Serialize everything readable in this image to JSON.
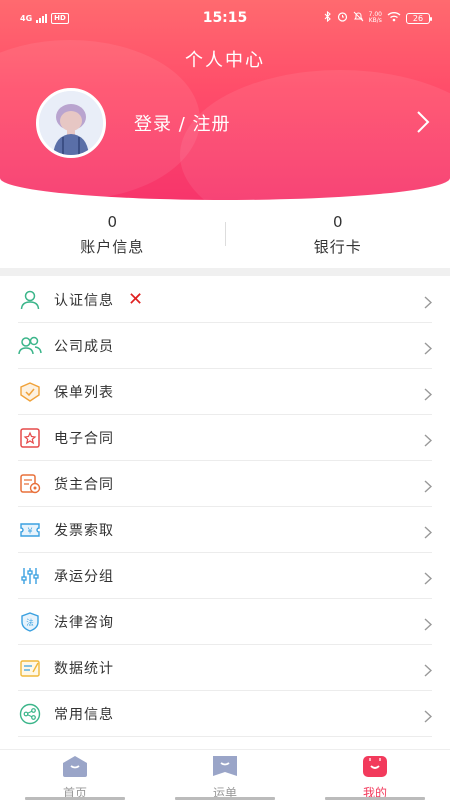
{
  "status_bar": {
    "network": "4G",
    "hd": "HD",
    "time": "15:15",
    "speed_value": "7.00",
    "speed_unit": "KB/s",
    "battery": "26"
  },
  "header": {
    "title": "个人中心",
    "login_label": "登录 / 注册"
  },
  "stats": [
    {
      "value": "0",
      "label": "账户信息"
    },
    {
      "value": "0",
      "label": "银行卡"
    }
  ],
  "menu": [
    {
      "label": "认证信息",
      "icon": "person-icon",
      "color": "#3bb58a",
      "status": "✕"
    },
    {
      "label": "公司成员",
      "icon": "group-icon",
      "color": "#3bb58a"
    },
    {
      "label": "保单列表",
      "icon": "policy-shield-icon",
      "color": "#f0a23a"
    },
    {
      "label": "电子合同",
      "icon": "e-contract-icon",
      "color": "#e64a4a"
    },
    {
      "label": "货主合同",
      "icon": "shipper-contract-icon",
      "color": "#e8703a"
    },
    {
      "label": "发票索取",
      "icon": "invoice-icon",
      "color": "#3aa0e0"
    },
    {
      "label": "承运分组",
      "icon": "sliders-icon",
      "color": "#3aa0e0"
    },
    {
      "label": "法律咨询",
      "icon": "law-shield-icon",
      "color": "#3aa0e0"
    },
    {
      "label": "数据统计",
      "icon": "statistics-icon",
      "color": "#f0b83a"
    },
    {
      "label": "常用信息",
      "icon": "share-icon",
      "color": "#3bb58a"
    }
  ],
  "bottom_nav": [
    {
      "label": "首页",
      "icon": "home-tab-icon",
      "active": false
    },
    {
      "label": "运单",
      "icon": "waybill-tab-icon",
      "active": false
    },
    {
      "label": "我的",
      "icon": "profile-tab-icon",
      "active": true
    }
  ],
  "colors": {
    "header_gradient_top": "#ff6a6f",
    "header_gradient_bottom": "#f7356b",
    "active_tab": "#f23a5c",
    "inactive_tab_icon": "#9aa5c8"
  }
}
